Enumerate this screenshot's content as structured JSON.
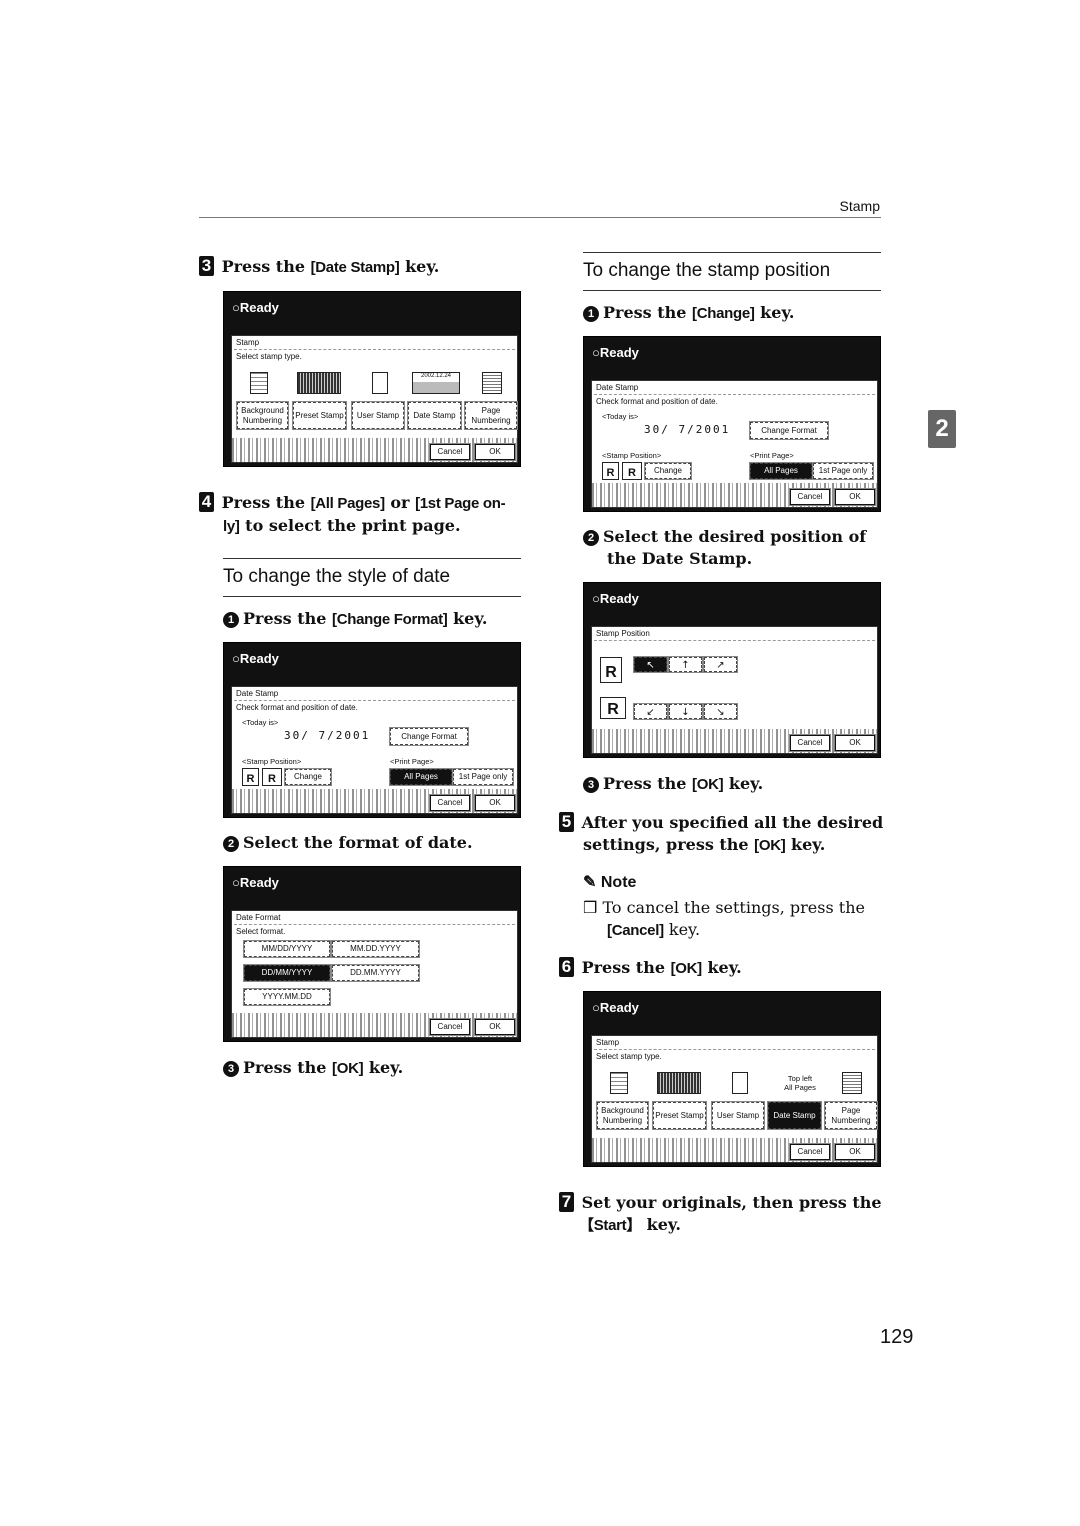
{
  "header": {
    "title": "Stamp"
  },
  "side_tab": "2",
  "page_number": "129",
  "left": {
    "step3": {
      "num": "3",
      "pre": "Press the ",
      "key": "[Date Stamp]",
      "post": " key."
    },
    "panel_stamp": {
      "status": "Ready",
      "title": "Stamp",
      "desc": "Select stamp type.",
      "icon_labels": {
        "date_icon": "2002.12.24"
      },
      "buttons": [
        "Background Numbering",
        "Preset Stamp",
        "User Stamp",
        "Date Stamp",
        "Page Numbering"
      ],
      "cancel": "Cancel",
      "ok": "OK"
    },
    "step4": {
      "num": "4",
      "pre": "Press the ",
      "key1": "[All Pages]",
      "mid": " or ",
      "key2a": "[1st Page on-",
      "key2b": "ly]",
      "post": " to select the print page."
    },
    "section_style": "To change the style of date",
    "sub1": {
      "num": "1",
      "pre": "Press the ",
      "key": "[Change Format]",
      "post": " key."
    },
    "panel_datestamp": {
      "status": "Ready",
      "title": "Date Stamp",
      "desc": "Check format and position of date.",
      "today_label": "<Today is>",
      "today_value": "30/ 7/2001",
      "change_format": "Change Format",
      "stamp_position_label": "<Stamp Position>",
      "change": "Change",
      "print_page_label": "<Print Page>",
      "all_pages": "All Pages",
      "first_page_only": "1st Page only",
      "cancel": "Cancel",
      "ok": "OK"
    },
    "sub2": {
      "num": "2",
      "text": "Select the format of date."
    },
    "panel_dateformat": {
      "status": "Ready",
      "title": "Date Format",
      "desc": "Select format.",
      "formats": [
        "MM/DD/YYYY",
        "MM.DD.YYYY",
        "DD/MM/YYYY",
        "DD.MM.YYYY",
        "YYYY.MM.DD"
      ],
      "selected": "DD/MM/YYYY",
      "cancel": "Cancel",
      "ok": "OK"
    },
    "sub3": {
      "num": "3",
      "pre": "Press the ",
      "key": "[OK]",
      "post": " key."
    }
  },
  "right": {
    "section_position": "To change the stamp position",
    "sub1": {
      "num": "1",
      "pre": "Press the ",
      "key": "[Change]",
      "post": " key."
    },
    "panel_datestamp": {
      "status": "Ready",
      "title": "Date Stamp",
      "desc": "Check format and position of date.",
      "today_label": "<Today is>",
      "today_value": "30/ 7/2001",
      "change_format": "Change Format",
      "stamp_position_label": "<Stamp Position>",
      "change": "Change",
      "print_page_label": "<Print Page>",
      "all_pages": "All Pages",
      "first_page_only": "1st Page only",
      "cancel": "Cancel",
      "ok": "OK"
    },
    "sub2": {
      "num": "2",
      "text1": "Select the desired position of",
      "text2": "the Date Stamp."
    },
    "panel_position": {
      "status": "Ready",
      "title": "Stamp Position",
      "arrows_top": [
        "↖",
        "↑",
        "↗"
      ],
      "arrows_bottom": [
        "↙",
        "↓",
        "↘"
      ],
      "selected": "↖",
      "cancel": "Cancel",
      "ok": "OK"
    },
    "sub3": {
      "num": "3",
      "pre": "Press the ",
      "key": "[OK]",
      "post": " key."
    },
    "step5": {
      "num": "5",
      "text1": "After you specified all the desired",
      "pre2": "settings, press the ",
      "key": "[OK]",
      "post": " key."
    },
    "note": {
      "title": "Note",
      "item_text": "To cancel the settings, press the",
      "item_key": "[Cancel]",
      "item_post": " key."
    },
    "step6": {
      "num": "6",
      "pre": "Press the ",
      "key": "[OK]",
      "post": " key."
    },
    "panel_stamp_final": {
      "status": "Ready",
      "title": "Stamp",
      "desc": "Select stamp type.",
      "date_info1": "Top left",
      "date_info2": "All Pages",
      "buttons": [
        "Background Numbering",
        "Preset Stamp",
        "User Stamp",
        "Date Stamp",
        "Page Numbering"
      ],
      "selected": "Date Stamp",
      "cancel": "Cancel",
      "ok": "OK"
    },
    "step7": {
      "num": "7",
      "text1": "Set your originals, then press the",
      "key": "【Start】",
      "post": " key."
    }
  }
}
